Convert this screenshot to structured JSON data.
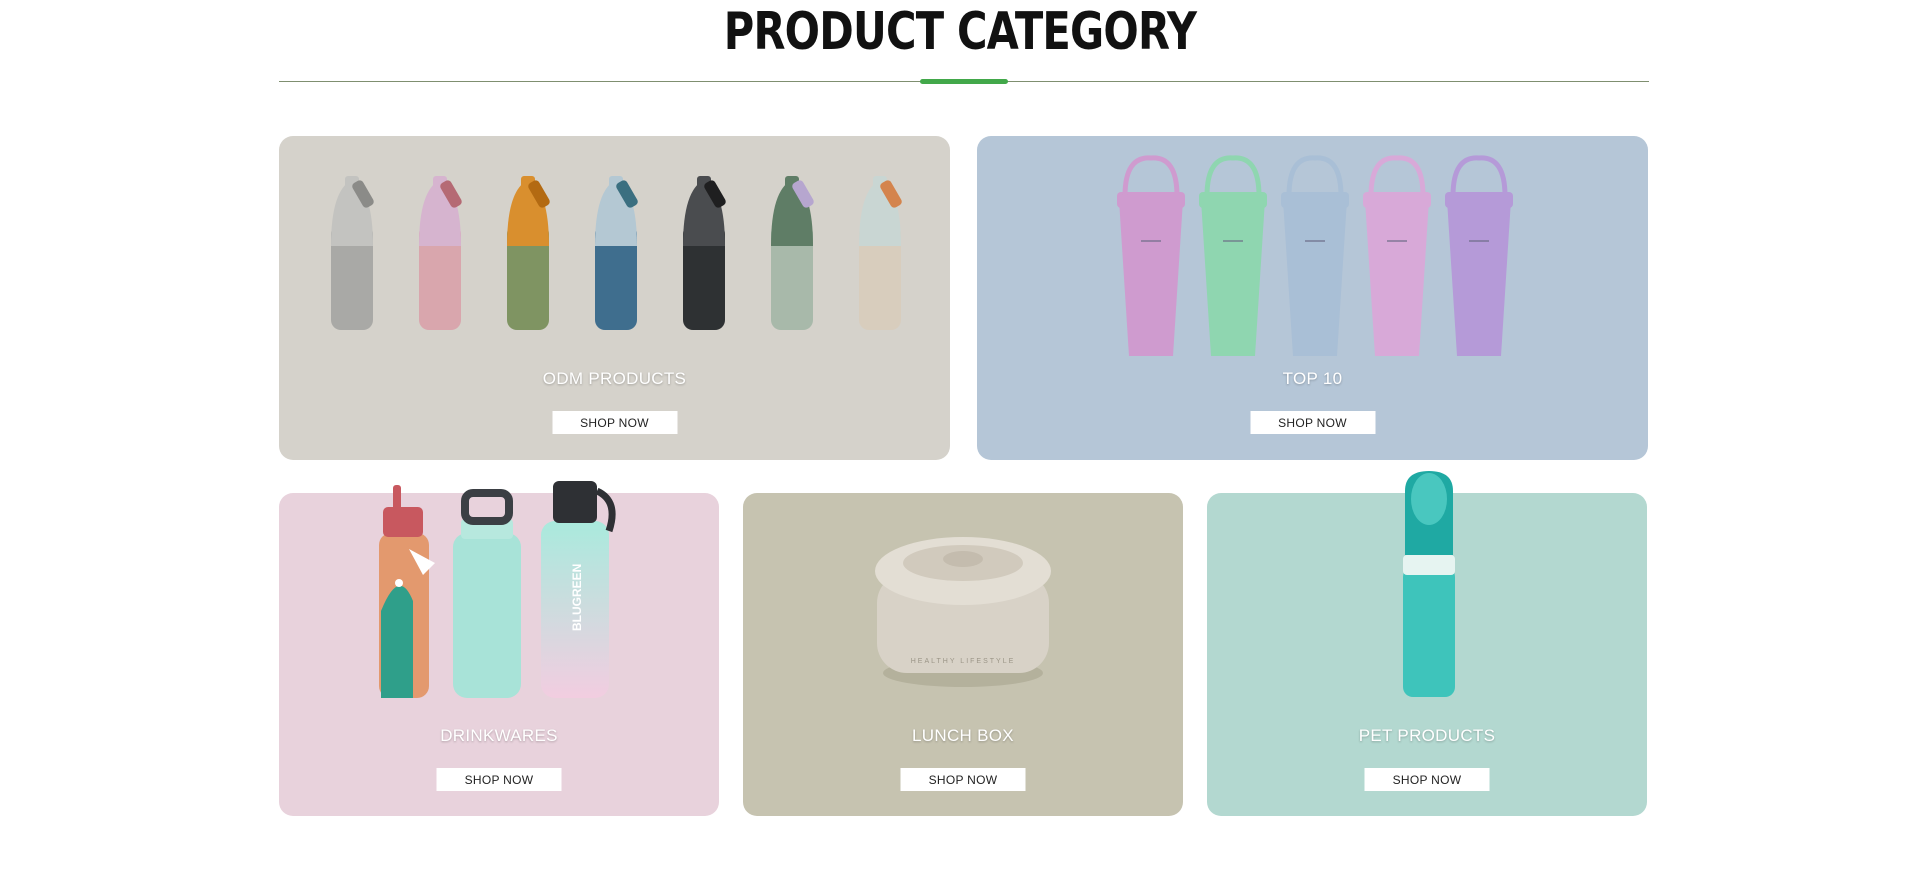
{
  "section": {
    "title": "PRODUCT CATEGORY"
  },
  "colors": {
    "accent": "#42a84a",
    "rule": "#7f8f70",
    "odm_bg": "#d5d2cb",
    "top10_bg": "#b5c6d7",
    "drink_bg": "#e8d2dc",
    "lunch_bg": "#c6c3b0",
    "pet_bg": "#b3d8d0"
  },
  "cards": [
    {
      "id": "odm",
      "label": "ODM PRODUCTS",
      "button": "SHOP NOW",
      "image": "spray-bottles-row"
    },
    {
      "id": "top10",
      "label": "TOP 10",
      "button": "SHOP NOW",
      "image": "tumblers-row"
    },
    {
      "id": "drinkwares",
      "label": "DRINKWARES",
      "button": "SHOP NOW",
      "image": "water-bottles-trio"
    },
    {
      "id": "lunchbox",
      "label": "LUNCH BOX",
      "button": "SHOP NOW",
      "image": "lunch-container"
    },
    {
      "id": "pet",
      "label": "PET PRODUCTS",
      "button": "SHOP NOW",
      "image": "pet-water-bottle"
    }
  ],
  "brand_print": "BLUGREEN",
  "lunchbox_print": "HEALTHY LIFESTYLE"
}
